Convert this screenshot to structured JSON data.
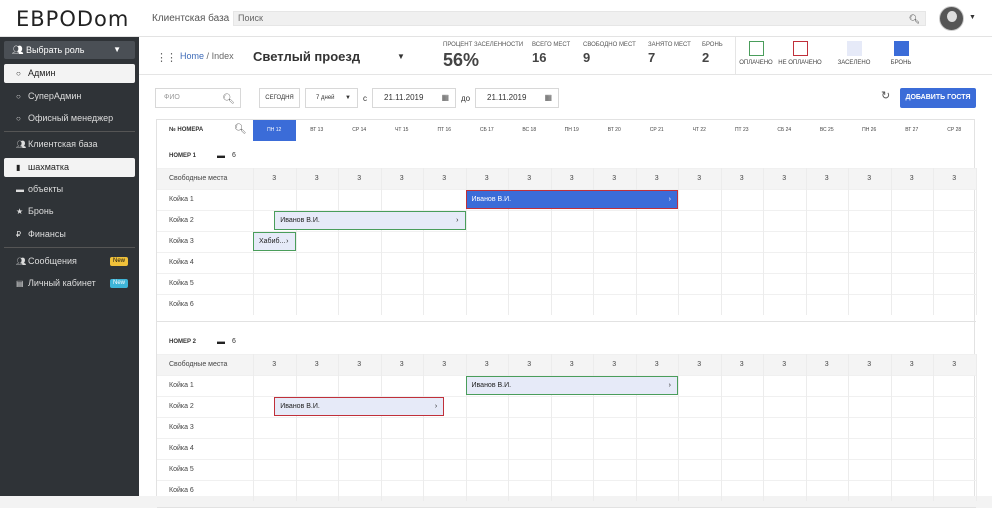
{
  "top": {
    "logo": "ЕВРОDom",
    "crm": "Клиентская база",
    "search_placeholder": "Поиск"
  },
  "sidebar": {
    "role_label": "Выбрать роль",
    "items": [
      {
        "label": "Админ",
        "icon": "circle-icon"
      },
      {
        "label": "СуперАдмин",
        "icon": "circle-icon"
      },
      {
        "label": "Офисный менеджер",
        "icon": "circle-icon"
      },
      {
        "label": "Клиентская база",
        "icon": "users-icon"
      },
      {
        "label": "шахматка",
        "icon": "file-icon"
      },
      {
        "label": "объекты",
        "icon": "bed-icon"
      },
      {
        "label": "Бронь",
        "icon": "star-icon"
      },
      {
        "label": "Финансы",
        "icon": "ruble-icon"
      },
      {
        "label": "Сообщения",
        "icon": "users-icon",
        "badge": "New"
      },
      {
        "label": "Личный кабинет",
        "icon": "id-card-icon",
        "badge": "New"
      }
    ]
  },
  "header": {
    "breadcrumb_home": "Home",
    "breadcrumb_sep": "/",
    "breadcrumb_current": "Index",
    "title": "Светлый проезд",
    "stats": [
      {
        "label": "ПРОЦЕНТ ЗАСЕЛЕННОСТИ",
        "value": "56%"
      },
      {
        "label": "ВСЕГО МЕСТ",
        "value": "16"
      },
      {
        "label": "СВОБОДНО МЕСТ",
        "value": "9"
      },
      {
        "label": "ЗАНЯТО МЕСТ",
        "value": "7"
      },
      {
        "label": "БРОНЬ",
        "value": "2"
      }
    ],
    "legend": [
      {
        "label": "ОПЛАЧЕНО",
        "border": "#4a9d5b",
        "fill": "#ffffff"
      },
      {
        "label": "НЕ ОПЛАЧЕНО",
        "border": "#c0303a",
        "fill": "#ffffff"
      },
      {
        "label": "ЗАСЕЛЕНО",
        "border": "#e6eaf8",
        "fill": "#e6eaf8"
      },
      {
        "label": "БРОНЬ",
        "border": "#3b6cd8",
        "fill": "#3b6cd8"
      }
    ]
  },
  "filters": {
    "fio_placeholder": "ФИО",
    "today_label": "СЕГОДНЯ",
    "period_value": "7 дней",
    "from_label": "с",
    "from_date": "21.11.2019",
    "to_label": "до",
    "to_date": "21.11.2019",
    "add_guest": "ДОБАВИТЬ ГОСТЯ"
  },
  "grid": {
    "number_header": "№ НОМЕРА",
    "days": [
      "ПН 12",
      "ВТ 13",
      "СР 14",
      "ЧТ 15",
      "ПТ 16",
      "СБ 17",
      "ВС 18",
      "ПН 19",
      "ВТ 20",
      "СР 21",
      "ЧТ 22",
      "ПТ 23",
      "СБ 24",
      "ВС 25",
      "ПН 26",
      "ВТ 27",
      "СР 28"
    ],
    "today_index": 0,
    "free_label": "Свободные места",
    "rooms": [
      {
        "title": "НОМЕР 1",
        "capacity": "6",
        "free": [
          "3",
          "3",
          "3",
          "3",
          "3",
          "3",
          "3",
          "3",
          "3",
          "3",
          "3",
          "3",
          "3",
          "3",
          "3",
          "3",
          "3"
        ],
        "beds": [
          "Койка 1",
          "Койка 2",
          "Койка 3",
          "Койка 4",
          "Койка 5",
          "Койка 6"
        ],
        "bookings": [
          {
            "bed": 0,
            "start": 5,
            "end": 10,
            "name": "Иванов В.И.",
            "status": "reserved-unpaid"
          },
          {
            "bed": 1,
            "start": 0.5,
            "end": 5,
            "name": "Иванов В.И.",
            "status": "settled-paid"
          },
          {
            "bed": 2,
            "start": 0,
            "end": 1,
            "name": "Хабиб...",
            "status": "settled-paid"
          }
        ]
      },
      {
        "title": "НОМЕР 2",
        "capacity": "6",
        "free": [
          "3",
          "3",
          "3",
          "3",
          "3",
          "3",
          "3",
          "3",
          "3",
          "3",
          "3",
          "3",
          "3",
          "3",
          "3",
          "3",
          "3"
        ],
        "beds": [
          "Койка 1",
          "Койка 2",
          "Койка 3",
          "Койка 4",
          "Койка 5",
          "Койка 6"
        ],
        "bookings": [
          {
            "bed": 0,
            "start": 5,
            "end": 10,
            "name": "Иванов В.И.",
            "status": "settled-paid"
          },
          {
            "bed": 1,
            "start": 0.5,
            "end": 4.5,
            "name": "Иванов В.И.",
            "status": "settled-unpaid"
          }
        ]
      }
    ]
  }
}
